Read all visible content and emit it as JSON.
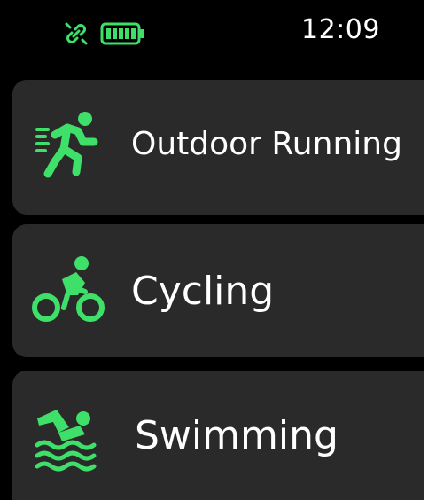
{
  "status_bar": {
    "time": "12:09",
    "icons": [
      "link-icon",
      "battery-icon"
    ],
    "battery_level": 1.0
  },
  "colors": {
    "accent": "#3ee06a",
    "card_background": "#2a2a2a",
    "screen_background": "#000000",
    "text": "#ffffff"
  },
  "menu": {
    "items": [
      {
        "label": "Outdoor Running",
        "icon": "running-icon"
      },
      {
        "label": "Cycling",
        "icon": "cycling-icon"
      },
      {
        "label": "Swimming",
        "icon": "swimming-icon"
      }
    ]
  }
}
